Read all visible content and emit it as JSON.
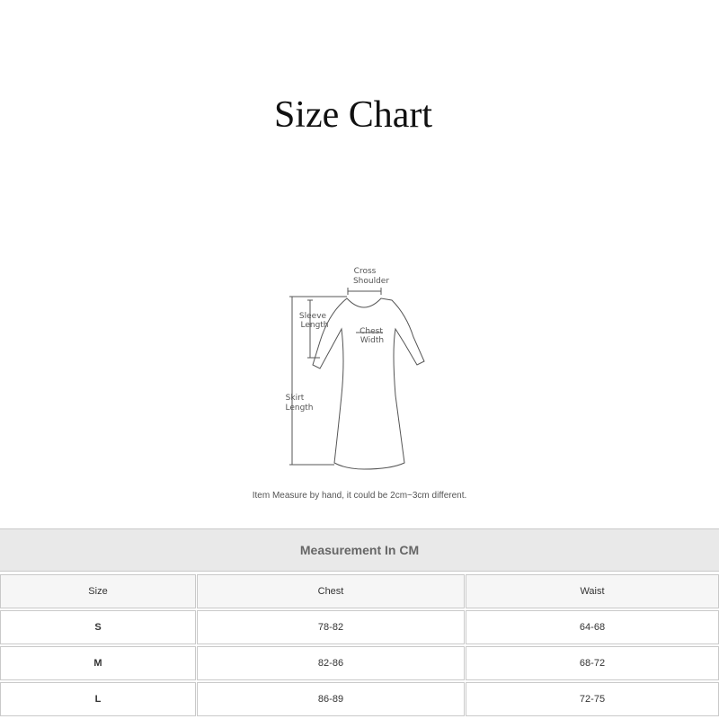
{
  "title": "Size Chart",
  "diagram": {
    "labels": {
      "cross_shoulder_1": "Cross",
      "cross_shoulder_2": "Shoulder",
      "sleeve_1": "Sleeve",
      "sleeve_2": "Length",
      "chest_1": "Chest",
      "chest_2": "Width",
      "skirt_1": "Skirt",
      "skirt_2": "Length"
    }
  },
  "note": "Item Measure by hand, it could be 2cm~3cm different.",
  "table": {
    "caption": "Measurement In CM",
    "columns": [
      "Size",
      "Chest",
      "Waist"
    ],
    "rows": [
      {
        "size": "S",
        "chest": "78-82",
        "waist": "64-68"
      },
      {
        "size": "M",
        "chest": "82-86",
        "waist": "68-72"
      },
      {
        "size": "L",
        "chest": "86-89",
        "waist": "72-75"
      }
    ]
  }
}
